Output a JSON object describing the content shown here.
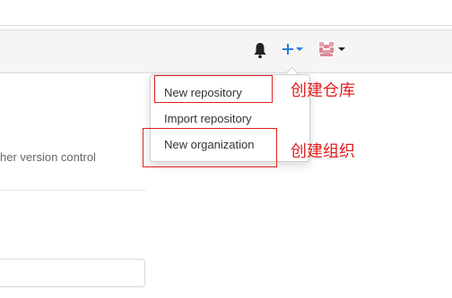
{
  "nav": {
    "icons": {
      "bell": "bell-icon",
      "plus": "plus-icon",
      "avatar": "avatar-icon"
    },
    "accent_color": "#2a7bd8"
  },
  "left_panel": {
    "partial_text": "her version control"
  },
  "dropdown": {
    "items": [
      {
        "label": "New repository"
      },
      {
        "label": "Import repository"
      },
      {
        "label": "New organization"
      }
    ]
  },
  "annotations": {
    "color": "#e02020",
    "labels": [
      {
        "text": "创建仓库"
      },
      {
        "text": "创建组织"
      }
    ]
  }
}
